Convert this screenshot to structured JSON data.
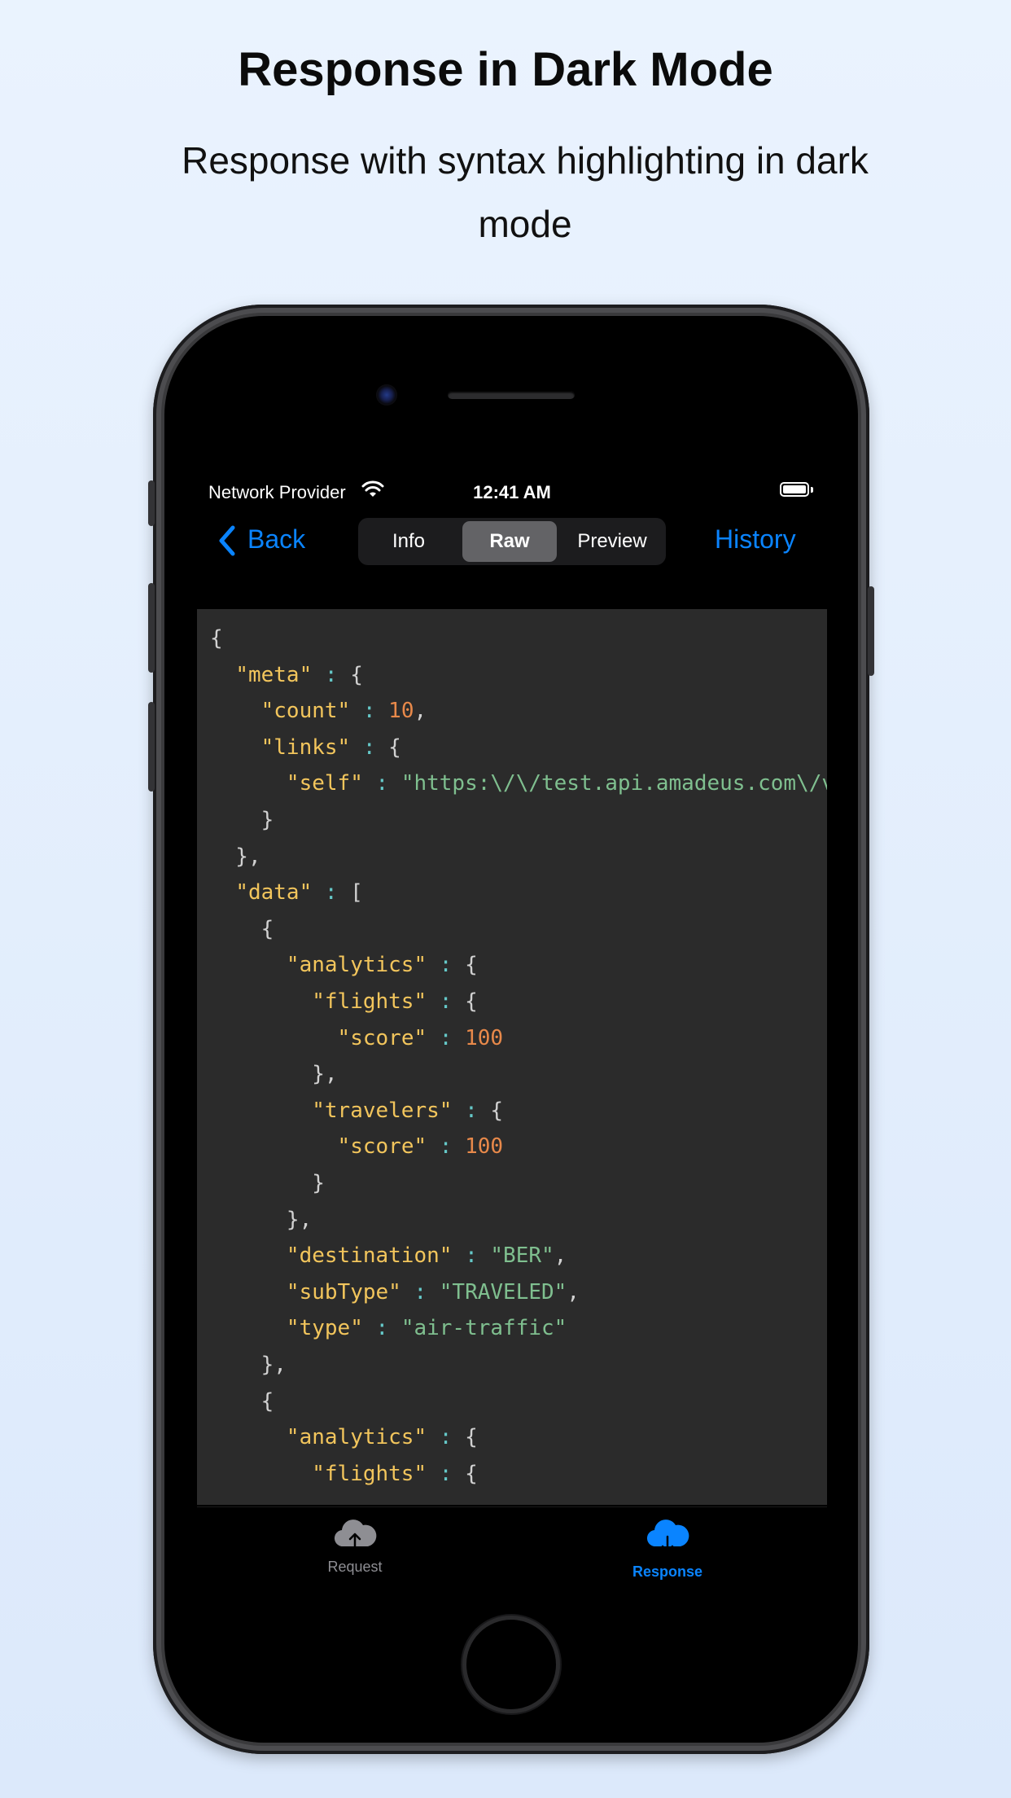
{
  "promo": {
    "title": "Response in Dark Mode",
    "subtitle": "Response with syntax highlighting in dark mode"
  },
  "status_bar": {
    "carrier": "Network Provider",
    "time": "12:41 AM"
  },
  "nav": {
    "back_label": "Back",
    "segments": [
      "Info",
      "Raw",
      "Preview"
    ],
    "selected_segment": "Raw",
    "history_label": "History"
  },
  "response_lines": [
    "{",
    "  \"meta\" : {",
    "    \"count\" : 10,",
    "    \"links\" : {",
    "      \"self\" : \"https:\\/\\/test.api.amadeus.com\\/v",
    "    }",
    "  },",
    "  \"data\" : [",
    "    {",
    "      \"analytics\" : {",
    "        \"flights\" : {",
    "          \"score\" : 100",
    "        },",
    "        \"travelers\" : {",
    "          \"score\" : 100",
    "        }",
    "      },",
    "      \"destination\" : \"BER\",",
    "      \"subType\" : \"TRAVELED\",",
    "      \"type\" : \"air-traffic\"",
    "    },",
    "    {",
    "      \"analytics\" : {",
    "        \"flights\" : {"
  ],
  "tab_bar": {
    "tabs": [
      {
        "label": "Request",
        "icon": "cloud-upload-icon",
        "selected": false
      },
      {
        "label": "Response",
        "icon": "cloud-download-icon",
        "selected": true
      }
    ]
  },
  "colors": {
    "accent": "#0a84ff",
    "code_background": "#2b2b2b",
    "json_key": "#f2c55c",
    "json_string": "#7fbf8f",
    "json_number": "#e8894a",
    "json_colon": "#65c8c8"
  }
}
